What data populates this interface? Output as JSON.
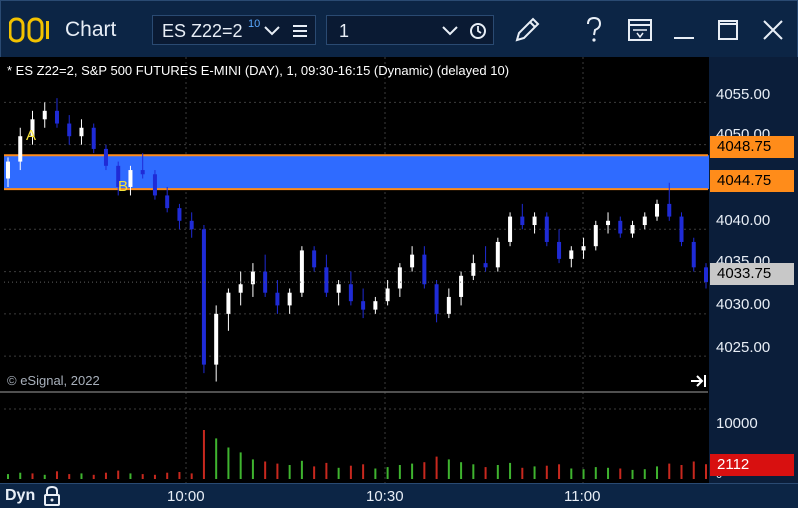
{
  "window": {
    "title": "Chart"
  },
  "toolbar": {
    "symbol": "ES Z22=2",
    "symbol_superscript": "10",
    "interval": "1"
  },
  "icons": {
    "app": "chart-app-icon",
    "symbol_dropdown": "chevron-down-icon",
    "symbol_menu": "hamburger-menu-icon",
    "interval_dropdown": "chevron-down-icon",
    "clock": "clock-icon",
    "draw": "pencil-icon",
    "help": "question-icon",
    "layout": "window-layout-icon",
    "minimize": "minimize-icon",
    "maximize": "maximize-icon",
    "close": "close-icon",
    "lock": "lock-icon",
    "scroll_to_end": "scroll-to-end-icon"
  },
  "chart": {
    "header": "* ES Z22=2, S&P 500 FUTURES E-MINI (DAY), 1, 09:30-16:15 (Dynamic) (delayed 10)",
    "copyright": "© eSignal, 2022",
    "price_ticks": [
      "4055.00",
      "4050.00",
      "4040.00",
      "4035.00",
      "4030.00",
      "4025.00"
    ],
    "zone_upper": "4048.75",
    "zone_lower": "4044.75",
    "last_price": "4033.75",
    "label_a": "A",
    "label_b": "B",
    "volume_tick": "10000",
    "volume_zero": "0",
    "last_volume": "2112",
    "time_ticks": [
      "10:00",
      "10:30",
      "11:00"
    ],
    "mode": "Dyn"
  },
  "colors": {
    "up_candle": "#ffffff",
    "down_candle": "#1f2bd6",
    "zone_fill": "#2f6bff",
    "zone_border": "#ff8c1a",
    "up_volume": "#3fb42f",
    "down_volume": "#c8281e",
    "last_price_box": "#c8c8c8",
    "last_volume_box": "#d81010"
  },
  "chart_data": {
    "type": "candlestick",
    "price_axis": {
      "min": 4021,
      "max": 4058,
      "ticks": [
        4025,
        4030,
        4035,
        4040,
        4050,
        4055
      ]
    },
    "zone": {
      "low": 4044.75,
      "high": 4048.75
    },
    "last_price": 4033.75,
    "volume_axis": {
      "max": 12000,
      "ticks": [
        10000
      ]
    },
    "last_volume": 2112,
    "time_axis": [
      "10:00",
      "10:30",
      "11:00"
    ],
    "series_ohlc_estimated": [
      [
        4046,
        4048.5,
        4045,
        4048
      ],
      [
        4048,
        4052,
        4047,
        4051
      ],
      [
        4051,
        4054,
        4050,
        4053
      ],
      [
        4053,
        4055,
        4052,
        4054
      ],
      [
        4054,
        4055.5,
        4052,
        4052.5
      ],
      [
        4052.5,
        4053.5,
        4050,
        4051
      ],
      [
        4051,
        4053,
        4050,
        4052
      ],
      [
        4052,
        4052.5,
        4049,
        4049.5
      ],
      [
        4049.5,
        4050,
        4047,
        4047.5
      ],
      [
        4047.5,
        4048,
        4044,
        4045
      ],
      [
        4045,
        4047.5,
        4044,
        4047
      ],
      [
        4047,
        4049,
        4046,
        4046.5
      ],
      [
        4046.5,
        4047,
        4043.5,
        4044
      ],
      [
        4044,
        4045,
        4042,
        4042.5
      ],
      [
        4042.5,
        4043,
        4040,
        4041
      ],
      [
        4041,
        4042,
        4039,
        4040
      ],
      [
        4040,
        4040.5,
        4023,
        4024
      ],
      [
        4024,
        4031,
        4022,
        4030
      ],
      [
        4030,
        4033,
        4028,
        4032.5
      ],
      [
        4032.5,
        4035,
        4031,
        4033.5
      ],
      [
        4033.5,
        4036,
        4032,
        4035
      ],
      [
        4035,
        4037,
        4032,
        4032.5
      ],
      [
        4032.5,
        4034,
        4030,
        4031
      ],
      [
        4031,
        4033,
        4030,
        4032.5
      ],
      [
        4032.5,
        4038,
        4032,
        4037.5
      ],
      [
        4037.5,
        4038,
        4035,
        4035.5
      ],
      [
        4035.5,
        4037,
        4032,
        4032.5
      ],
      [
        4032.5,
        4034,
        4031,
        4033.5
      ],
      [
        4033.5,
        4035,
        4031,
        4031.5
      ],
      [
        4031.5,
        4033,
        4029.5,
        4030.5
      ],
      [
        4030.5,
        4032,
        4030,
        4031.5
      ],
      [
        4031.5,
        4034,
        4031,
        4033
      ],
      [
        4033,
        4036,
        4032,
        4035.5
      ],
      [
        4035.5,
        4038,
        4035,
        4037
      ],
      [
        4037,
        4038,
        4033,
        4033.5
      ],
      [
        4033.5,
        4034,
        4029,
        4030
      ],
      [
        4030,
        4033,
        4029.5,
        4032
      ],
      [
        4032,
        4035,
        4031,
        4034.5
      ],
      [
        4034.5,
        4037,
        4034,
        4036
      ],
      [
        4036,
        4038,
        4035,
        4035.5
      ],
      [
        4035.5,
        4039,
        4035,
        4038.5
      ],
      [
        4038.5,
        4042,
        4038,
        4041.5
      ],
      [
        4041.5,
        4043,
        4040,
        4040.5
      ],
      [
        4040.5,
        4042,
        4039.5,
        4041.5
      ],
      [
        4041.5,
        4042,
        4038,
        4038.5
      ],
      [
        4038.5,
        4040,
        4036,
        4036.5
      ],
      [
        4036.5,
        4038,
        4035.5,
        4037.5
      ],
      [
        4037.5,
        4039,
        4036.5,
        4038
      ],
      [
        4038,
        4041,
        4037.5,
        4040.5
      ],
      [
        4040.5,
        4042,
        4039.5,
        4041
      ],
      [
        4041,
        4041.5,
        4039,
        4039.5
      ],
      [
        4039.5,
        4041,
        4039,
        4040.5
      ],
      [
        4040.5,
        4042,
        4040,
        4041.5
      ],
      [
        4041.5,
        4043.5,
        4041,
        4043
      ],
      [
        4043,
        4045.5,
        4041,
        4041.5
      ],
      [
        4041.5,
        4042,
        4038,
        4038.5
      ],
      [
        4038.5,
        4039,
        4035,
        4035.5
      ],
      [
        4035.5,
        4036,
        4033,
        4033.75
      ]
    ],
    "volume_estimated": [
      [
        700,
        1
      ],
      [
        900,
        1
      ],
      [
        800,
        0
      ],
      [
        600,
        1
      ],
      [
        1100,
        0
      ],
      [
        700,
        0
      ],
      [
        800,
        1
      ],
      [
        600,
        0
      ],
      [
        900,
        0
      ],
      [
        1200,
        0
      ],
      [
        800,
        1
      ],
      [
        700,
        0
      ],
      [
        600,
        0
      ],
      [
        900,
        0
      ],
      [
        1000,
        0
      ],
      [
        800,
        0
      ],
      [
        7000,
        0
      ],
      [
        5800,
        1
      ],
      [
        4500,
        1
      ],
      [
        3800,
        1
      ],
      [
        2800,
        1
      ],
      [
        2500,
        0
      ],
      [
        2200,
        0
      ],
      [
        2000,
        1
      ],
      [
        2600,
        1
      ],
      [
        1800,
        0
      ],
      [
        2300,
        0
      ],
      [
        1600,
        1
      ],
      [
        1900,
        0
      ],
      [
        2100,
        0
      ],
      [
        1500,
        1
      ],
      [
        1700,
        1
      ],
      [
        2000,
        1
      ],
      [
        2200,
        1
      ],
      [
        2400,
        0
      ],
      [
        3200,
        0
      ],
      [
        2800,
        1
      ],
      [
        2400,
        1
      ],
      [
        2100,
        1
      ],
      [
        1700,
        0
      ],
      [
        2000,
        1
      ],
      [
        2300,
        1
      ],
      [
        1600,
        0
      ],
      [
        1800,
        1
      ],
      [
        1900,
        0
      ],
      [
        2100,
        0
      ],
      [
        1500,
        1
      ],
      [
        1400,
        1
      ],
      [
        1700,
        1
      ],
      [
        1600,
        1
      ],
      [
        1500,
        0
      ],
      [
        1300,
        1
      ],
      [
        1400,
        1
      ],
      [
        1800,
        1
      ],
      [
        2200,
        0
      ],
      [
        2000,
        0
      ],
      [
        2500,
        0
      ],
      [
        2112,
        0
      ]
    ]
  }
}
